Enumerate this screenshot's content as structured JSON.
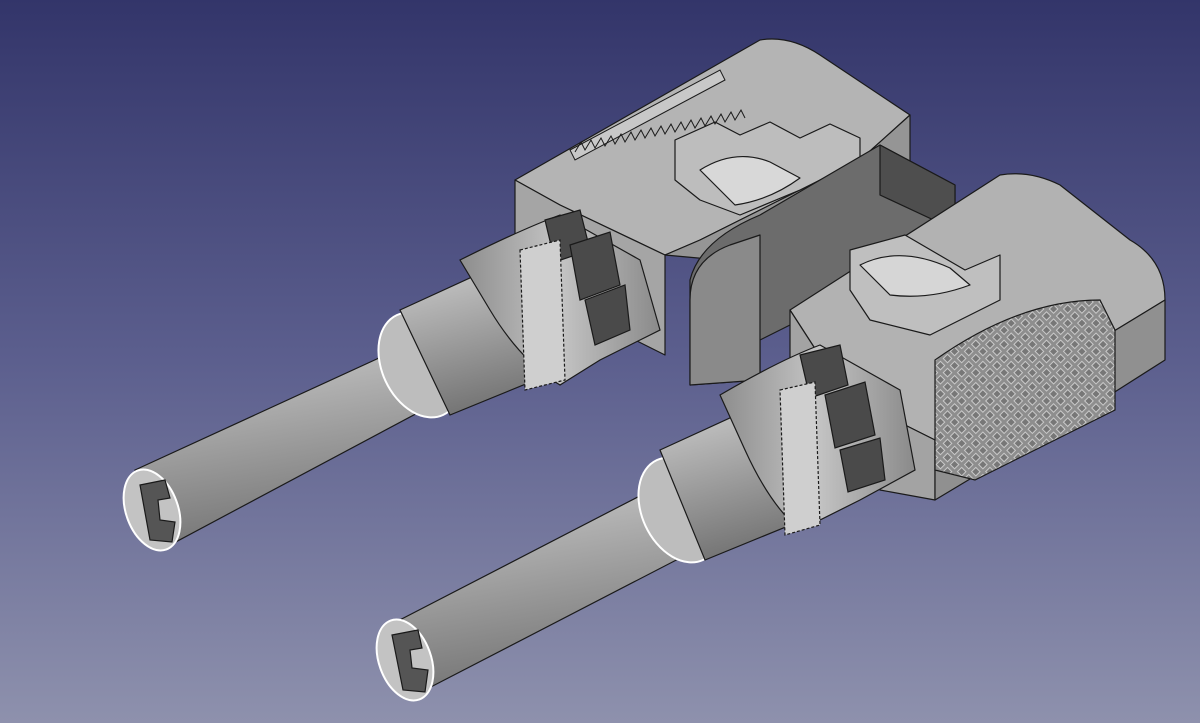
{
  "viewport": {
    "background_top": "#33356a",
    "background_bottom": "#8e91ad",
    "render_style": "shaded with edges",
    "model_color": "#a8a8a8",
    "edge_color": "#1a1a1a",
    "highlight_edge_color": "#ffffff"
  },
  "model": {
    "parts": [
      "rear-clamp-block",
      "front-clamp-block",
      "center-bridge",
      "left-cage-nut",
      "right-cage-nut",
      "left-probe-shaft",
      "right-probe-shaft",
      "knurled-grip",
      "serrated-ridge"
    ]
  }
}
